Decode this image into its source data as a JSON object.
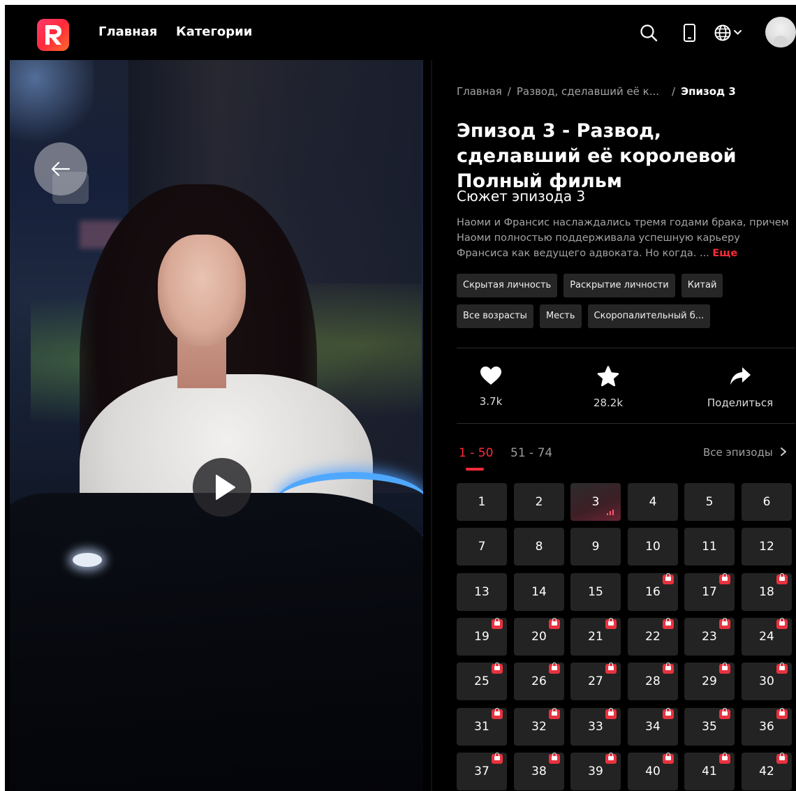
{
  "nav": {
    "home": "Главная",
    "categories": "Категории",
    "icons": [
      "search-icon",
      "phone-icon",
      "globe-icon",
      "avatar"
    ]
  },
  "breadcrumb": {
    "home": "Главная",
    "series": "Развод, сделавший её к...",
    "current": "Эпизод 3"
  },
  "episode": {
    "title": "Эпизод 3 - Развод, сделавший её королевой Полный фильм",
    "plot_heading": "Сюжет эпизода 3",
    "plot_text": "Наоми и Франсис наслаждались тремя годами брака, причем Наоми полностью поддерживала успешную карьеру Франсиса как ведущего адвоката. Но когда. ...",
    "more": "Еще"
  },
  "tags": [
    "Скрытая личность",
    "Раскрытие личности",
    "Китай",
    "Все возрасты",
    "Месть",
    "Скоропалительный б..."
  ],
  "actions": {
    "likes": "3.7k",
    "favorites": "28.2k",
    "share": "Поделиться"
  },
  "episodes_panel": {
    "ranges": [
      "1 - 50",
      "51 - 74"
    ],
    "all": "Все эпизоды",
    "current": 3,
    "free_until": 15,
    "visible_from": 1,
    "visible_to": 42
  },
  "colors": {
    "accent": "#ff2b3a",
    "background": "#000000",
    "tile": "#232323"
  }
}
